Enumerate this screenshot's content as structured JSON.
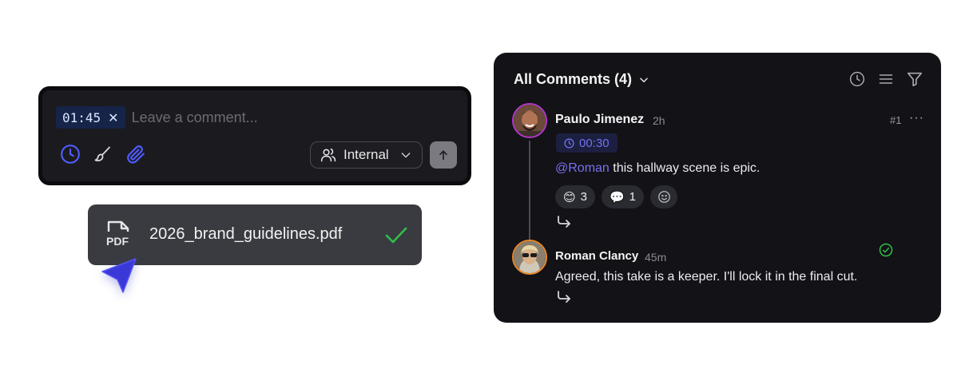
{
  "composer": {
    "timestamp": "01:45",
    "clear_symbol": "✕",
    "placeholder": "Leave a comment...",
    "tools": [
      "clock-icon",
      "brush-icon",
      "paperclip-icon"
    ],
    "visibility_label": "Internal",
    "accent_color": "#4f5bff"
  },
  "upload": {
    "file_type_label": "PDF",
    "file_name": "2026_brand_guidelines.pdf",
    "status_color": "#2fbf4a"
  },
  "comments_panel": {
    "title": "All Comments (4)",
    "actions": [
      "clock-icon",
      "list-icon",
      "filter-icon"
    ],
    "comments": [
      {
        "author": "Paulo Jimenez",
        "time_ago": "2h",
        "number": "#1",
        "more": "···",
        "timestamp": "00:30",
        "mention": "@Roman",
        "body": " this hallway scene is epic.",
        "reactions": [
          {
            "emoji": "😊",
            "count": "3"
          },
          {
            "emoji": "💬",
            "count": "1"
          }
        ],
        "avatar_ring": "#b338c8"
      },
      {
        "author": "Roman Clancy",
        "time_ago": "45m",
        "body": "Agreed, this take is a keeper. I'll lock it in the final cut.",
        "resolved": true,
        "avatar_ring": "#e8892a"
      }
    ]
  }
}
